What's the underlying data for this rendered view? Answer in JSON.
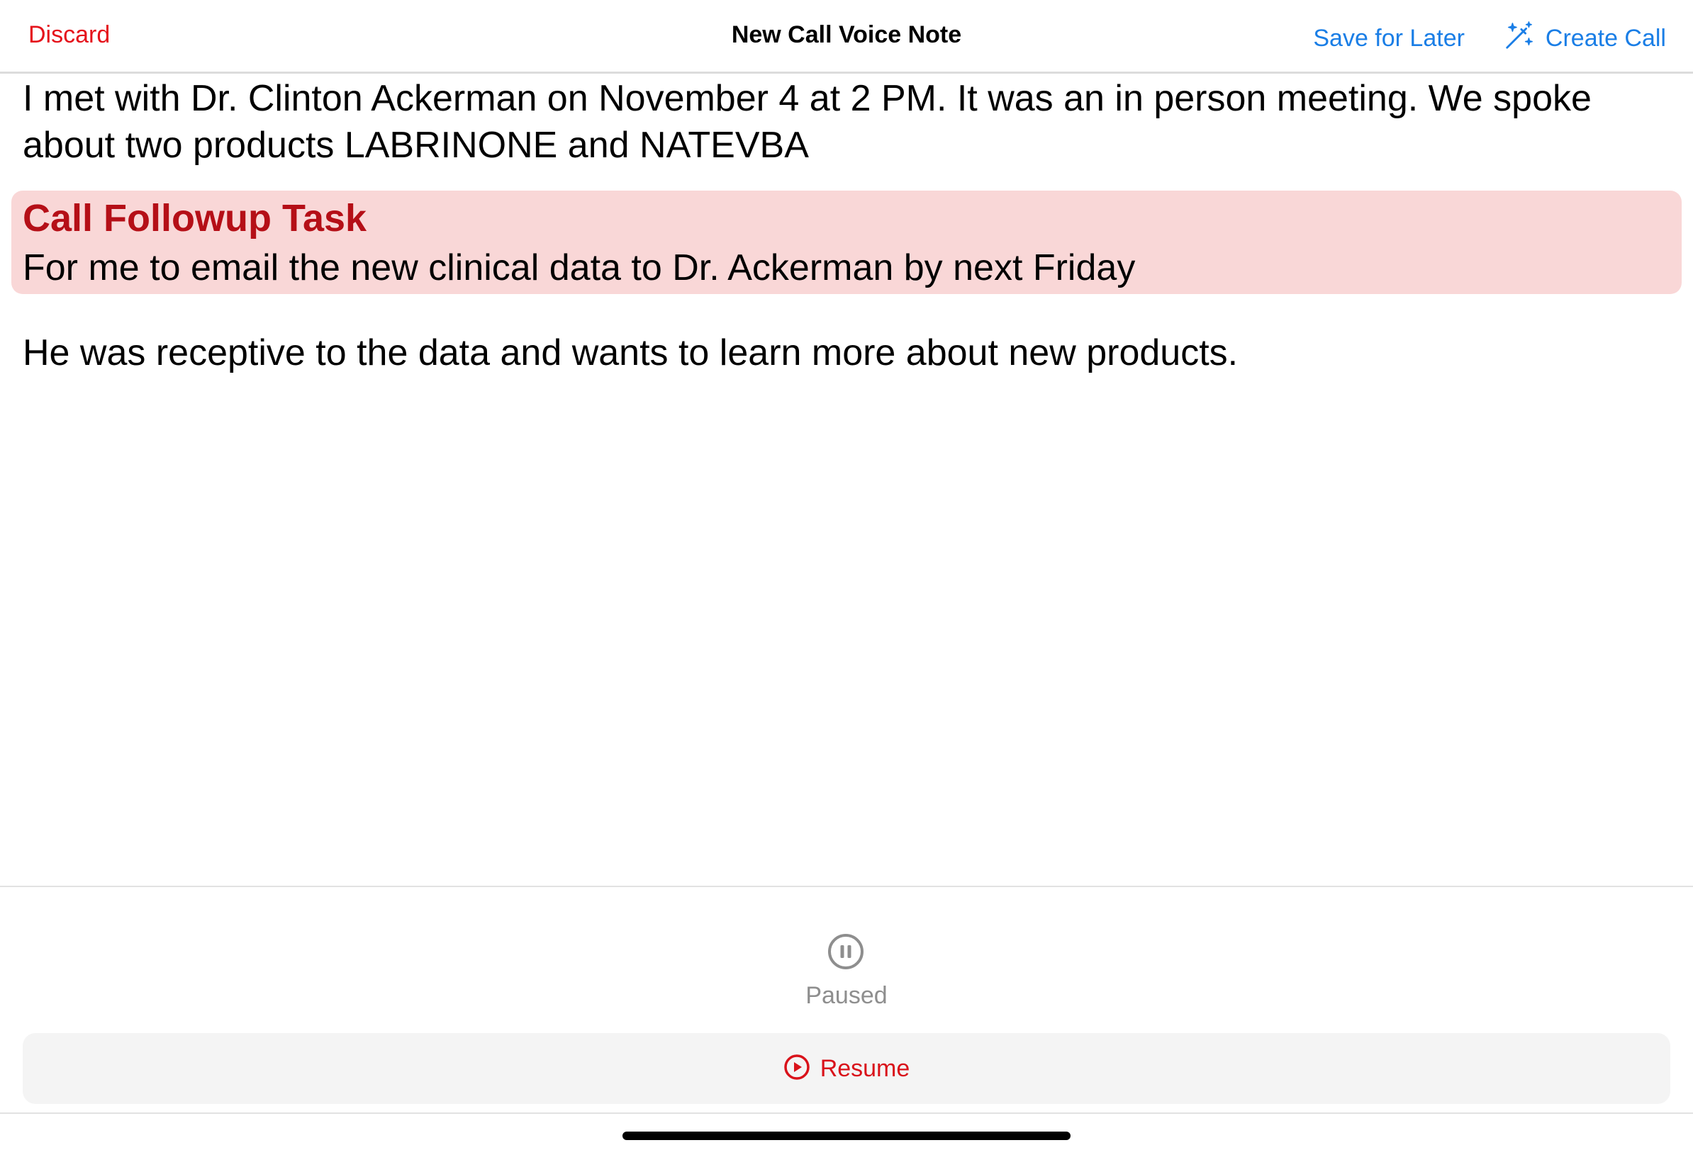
{
  "navbar": {
    "discard_label": "Discard",
    "title": "New Call Voice Note",
    "save_later_label": "Save for Later",
    "create_call_label": "Create Call",
    "create_call_icon": "magic-wand-icon"
  },
  "note": {
    "paragraph1": "I met with Dr. Clinton Ackerman on November 4 at 2 PM. It was an in person meeting. We spoke about two products LABRINONE and NATEVBA",
    "task": {
      "title": "Call Followup Task",
      "body": "For me to email the new clinical data to Dr. Ackerman by next Friday"
    },
    "paragraph2": "He was receptive to the data and wants to learn more about new products."
  },
  "recorder": {
    "status_icon": "pause-circle-icon",
    "status": "Paused",
    "resume_icon": "play-circle-icon",
    "resume_label": "Resume"
  },
  "colors": {
    "accent_blue": "#1a7ee6",
    "destructive_red": "#e5121b",
    "task_background": "#f9d7d7",
    "task_title": "#b50f17"
  }
}
